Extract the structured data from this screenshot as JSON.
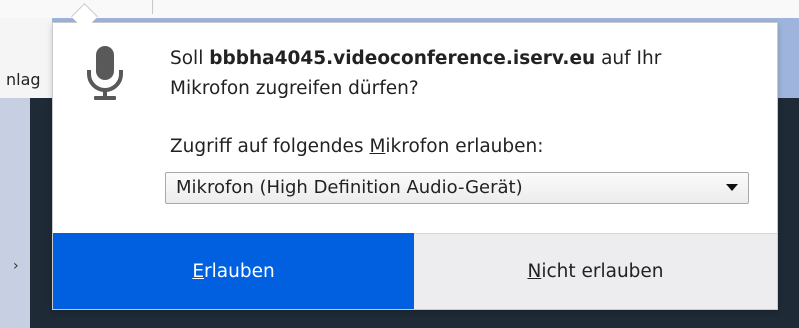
{
  "background_page": {
    "left_fragment": "nlag",
    "left_glyph": "›"
  },
  "popup": {
    "icon": "microphone-icon",
    "message": {
      "prefix": "Soll ",
      "host": "bbbha4045.videoconference.iserv.eu",
      "suffix_line1": " auf Ihr",
      "line2": "Mikrofon zugreifen dürfen?"
    },
    "select_label": {
      "before": "Zugriff auf folgendes ",
      "access_key": "M",
      "after": "ikrofon erlauben:"
    },
    "device_select": {
      "selected": "Mikrofon (High Definition Audio-Gerät)"
    },
    "buttons": {
      "allow": {
        "access_key": "E",
        "rest": "rlauben"
      },
      "deny": {
        "access_key": "N",
        "rest": "icht erlauben"
      }
    }
  },
  "colors": {
    "allow_button": "#0060df",
    "deny_button": "#ededf0",
    "page_dark": "#1e2a36",
    "frame": "#9fb4dc"
  }
}
